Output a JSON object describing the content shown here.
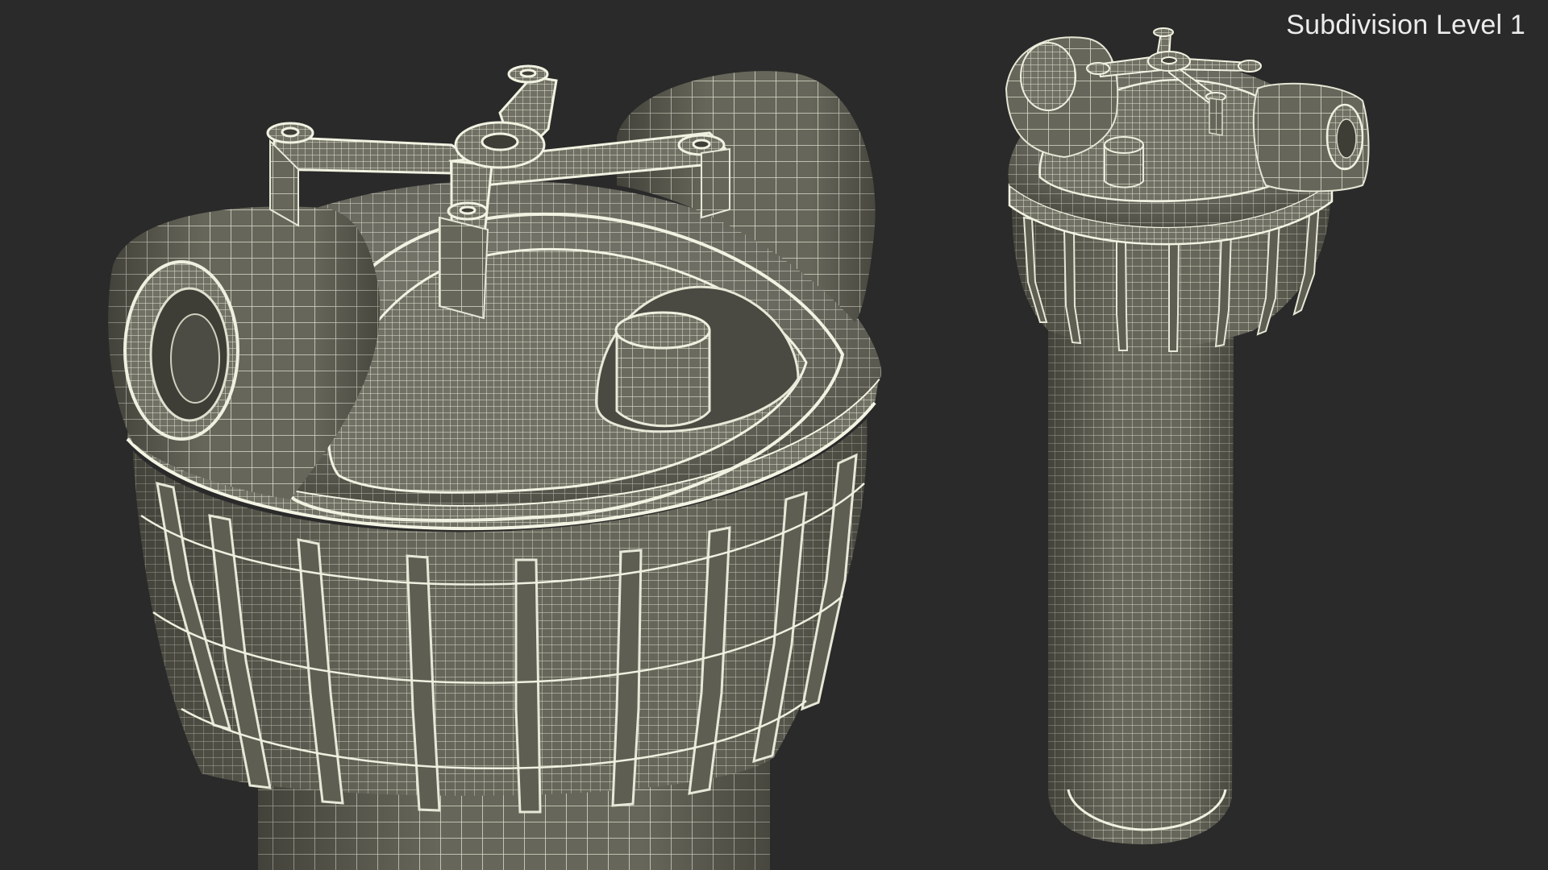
{
  "viewport": {
    "caption": "Subdivision Level 1"
  },
  "scene": {
    "objects": [
      {
        "name": "water-filter-housing-closeup",
        "view": "close-up"
      },
      {
        "name": "water-filter-housing-full",
        "view": "full"
      }
    ]
  },
  "colors": {
    "background": "#2a2a2a",
    "surface_fill": "#6b6b5f",
    "surface_shade": "#55554b",
    "wire": "#e4e4d4",
    "wire_dim": "#b9b9a9",
    "caption_text": "#ececec"
  }
}
